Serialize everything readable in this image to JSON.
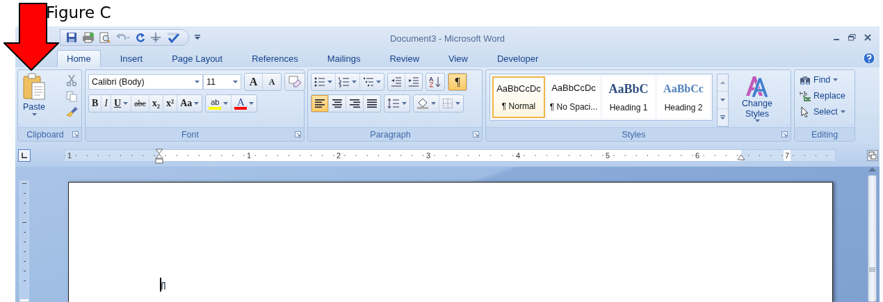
{
  "caption": "Figure C",
  "window": {
    "title": "Document3 - Microsoft Word"
  },
  "tabs": [
    {
      "label": "Home",
      "selected": true
    },
    {
      "label": "Insert",
      "selected": false
    },
    {
      "label": "Page Layout",
      "selected": false
    },
    {
      "label": "References",
      "selected": false
    },
    {
      "label": "Mailings",
      "selected": false
    },
    {
      "label": "Review",
      "selected": false
    },
    {
      "label": "View",
      "selected": false
    },
    {
      "label": "Developer",
      "selected": false
    }
  ],
  "clipboard": {
    "label": "Clipboard",
    "paste": "Paste"
  },
  "font": {
    "label": "Font",
    "name": "Calibri (Body)",
    "size": "11",
    "size_buttons": [
      {
        "kind": "grow",
        "glyph": "A"
      },
      {
        "kind": "shrink",
        "glyph": "A"
      }
    ],
    "format_buttons": [
      {
        "kind": "bold",
        "glyph": "B",
        "dropdown": false
      },
      {
        "kind": "italic",
        "glyph": "I",
        "dropdown": false
      },
      {
        "kind": "underline",
        "glyph": "U",
        "dropdown": true
      },
      {
        "kind": "strikethrough",
        "glyph": "abc",
        "dropdown": false
      },
      {
        "kind": "subscript",
        "glyph": "x₂",
        "dropdown": false
      },
      {
        "kind": "superscript",
        "glyph": "x²",
        "dropdown": false
      },
      {
        "kind": "case",
        "glyph": "Aa",
        "dropdown": true
      }
    ],
    "color_buttons": [
      {
        "kind": "highlight",
        "glyph": "ab",
        "color": "#ffff00"
      },
      {
        "kind": "font_color",
        "glyph": "A",
        "color": "#ff0000"
      }
    ]
  },
  "paragraph": {
    "label": "Paragraph",
    "show_marks": {
      "glyph": "¶",
      "selected": true
    },
    "alignments": [
      {
        "kind": "left",
        "selected": true
      },
      {
        "kind": "center",
        "selected": false
      },
      {
        "kind": "right",
        "selected": false
      },
      {
        "kind": "justify",
        "selected": false
      }
    ]
  },
  "styles": {
    "label": "Styles",
    "change_styles": "Change Styles",
    "items": [
      {
        "kind": "normal",
        "preview": "AaBbCcDc",
        "name": "¶ Normal",
        "selected": true
      },
      {
        "kind": "normal",
        "preview": "AaBbCcDc",
        "name": "¶ No Spaci...",
        "selected": false
      },
      {
        "kind": "heading1",
        "preview": "AaBbC",
        "name": "Heading 1",
        "selected": false
      },
      {
        "kind": "heading2",
        "preview": "AaBbCc",
        "name": "Heading 2",
        "selected": false
      }
    ]
  },
  "editing": {
    "label": "Editing",
    "commands": [
      {
        "kind": "find",
        "label": "Find",
        "dropdown": true
      },
      {
        "kind": "replace",
        "label": "Replace",
        "dropdown": false
      },
      {
        "kind": "select",
        "label": "Select",
        "dropdown": true
      }
    ]
  },
  "ruler": {
    "numbers": [
      "1",
      "1",
      "2",
      "3",
      "4",
      "5",
      "6",
      "7"
    ]
  }
}
